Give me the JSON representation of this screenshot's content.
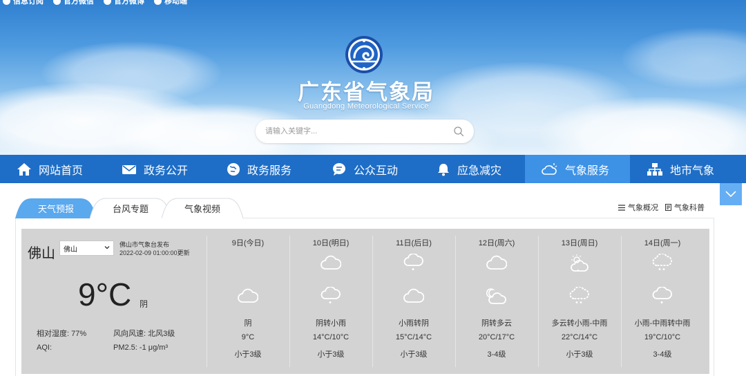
{
  "topbar": {
    "items": [
      "信息订阅",
      "官方微信",
      "官方微博",
      "移动端"
    ]
  },
  "site": {
    "title": "广东省气象局",
    "subtitle": "Guangdong Meteorological Service"
  },
  "search": {
    "placeholder": "请输入关键字..."
  },
  "nav": {
    "items": [
      {
        "label": "网站首页",
        "icon": "home-icon"
      },
      {
        "label": "政务公开",
        "icon": "mail-icon"
      },
      {
        "label": "政务服务",
        "icon": "globe-icon"
      },
      {
        "label": "公众互动",
        "icon": "chat-icon"
      },
      {
        "label": "应急减灾",
        "icon": "bell-icon"
      },
      {
        "label": "气象服务",
        "icon": "weather-icon",
        "active": true
      },
      {
        "label": "地市气象",
        "icon": "sitemap-icon"
      }
    ]
  },
  "tabs": [
    {
      "label": "天气预报",
      "active": true
    },
    {
      "label": "台风专题",
      "active": false
    },
    {
      "label": "气象视频",
      "active": false
    }
  ],
  "right_links": {
    "overview": "气象概况",
    "science": "气象科普"
  },
  "current": {
    "city": "佛山",
    "city_select": "佛山",
    "publisher": "佛山市气象台发布",
    "updated": "2022-02-09 01:00:00更新",
    "temperature": "9°C",
    "condition": "阴",
    "humidity_label": "相对湿度:",
    "humidity": "77%",
    "wind_label": "风向风速:",
    "wind": "北风3级",
    "aqi_label": "AQI:",
    "aqi": "",
    "pm25_label": "PM2.5:",
    "pm25": "-1 μg/m³"
  },
  "forecast": [
    {
      "date": "9日(今日)",
      "desc": "阴",
      "temp": "9°C",
      "wind": "小于3级",
      "icon1": "",
      "icon2": "cloud-icon"
    },
    {
      "date": "10日(明日)",
      "desc": "阴转小雨",
      "temp": "14°C/10°C",
      "wind": "小于3级",
      "icon1": "cloud-icon",
      "icon2": "light-rain-icon"
    },
    {
      "date": "11日(后日)",
      "desc": "小雨转阴",
      "temp": "15°C/14°C",
      "wind": "小于3级",
      "icon1": "light-rain-icon",
      "icon2": "cloud-icon"
    },
    {
      "date": "12日(周六)",
      "desc": "阴转多云",
      "temp": "20°C/17°C",
      "wind": "3-4级",
      "icon1": "cloud-icon",
      "icon2": "moon-cloud-icon"
    },
    {
      "date": "13日(周日)",
      "desc": "多云转小雨-中雨",
      "temp": "22°C/14°C",
      "wind": "小于3级",
      "icon1": "sun-cloud-icon",
      "icon2": "rain-icon"
    },
    {
      "date": "14日(周一)",
      "desc": "小雨-中雨转中雨",
      "temp": "19°C/10°C",
      "wind": "3-4级",
      "icon1": "rain-icon",
      "icon2": "light-rain-icon"
    }
  ],
  "colors": {
    "nav_bg": "#1e6ec7",
    "nav_active": "#3d92e6",
    "panel_bg": "#d3d3d3",
    "tab_active": "#5aa8ee"
  }
}
